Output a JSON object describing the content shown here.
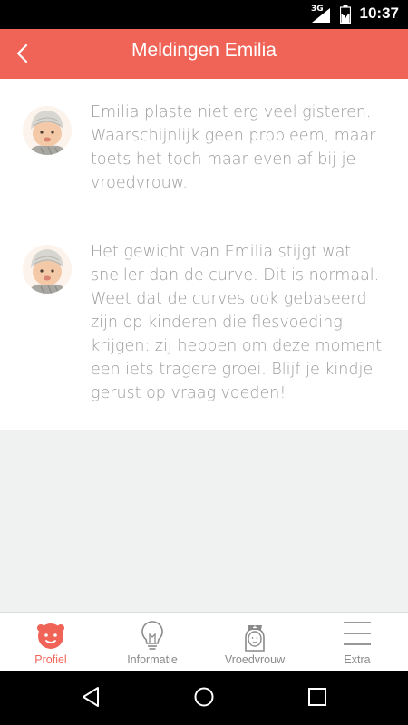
{
  "status_bar": {
    "network": "3G",
    "time": "10:37"
  },
  "header": {
    "title": "Meldingen Emilia",
    "back_icon": "chevron-left-icon"
  },
  "notifications": [
    {
      "avatar": "baby-photo",
      "text": "Emilia plaste niet erg veel gisteren. Waarschijnlijk geen probleem, maar toets het toch maar even af bij je vroedvrouw."
    },
    {
      "avatar": "baby-photo",
      "text": "Het gewicht van Emilia stijgt wat sneller dan de curve. Dit is normaal. Weet dat de curves ook gebaseerd zijn op kinderen die flesvoeding krijgen: zij hebben om deze moment een iets tragere groei. Blijf je kindje gerust op vraag voeden!"
    }
  ],
  "tabs": [
    {
      "label": "Profiel",
      "icon": "baby-face-icon",
      "active": true
    },
    {
      "label": "Informatie",
      "icon": "lightbulb-icon",
      "active": false
    },
    {
      "label": "Vroedvrouw",
      "icon": "nurse-icon",
      "active": false
    },
    {
      "label": "Extra",
      "icon": "menu-icon",
      "active": false
    }
  ],
  "colors": {
    "accent": "#ef6457",
    "text_muted": "#9b9b9b",
    "background": "#f0f2f2"
  }
}
